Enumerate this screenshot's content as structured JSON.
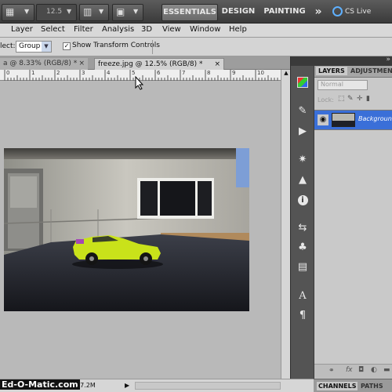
{
  "appbar": {
    "zoom_value": "12.5",
    "workspaces": [
      "ESSENTIALS",
      "DESIGN",
      "PAINTING"
    ],
    "more_label": "»",
    "cslive_label": "CS Live"
  },
  "menu": [
    "Layer",
    "Select",
    "Filter",
    "Analysis",
    "3D",
    "View",
    "Window",
    "Help"
  ],
  "options": {
    "select_label": "lect:",
    "select_value": "Group",
    "transform_label": "Show Transform Controls"
  },
  "tabs": [
    {
      "label": "a @ 8.33% (RGB/8) *",
      "close": "×"
    },
    {
      "label": "freeze.jpg @ 12.5% (RGB/8) *",
      "close": "×"
    }
  ],
  "ruler_labels": [
    "0",
    "1",
    "2",
    "3",
    "4",
    "5",
    "6",
    "7",
    "8",
    "9",
    "10",
    "11"
  ],
  "panel": {
    "tabs": [
      "LAYERS",
      "ADJUSTMENTS"
    ],
    "blend_mode": "Normal",
    "lock_label": "Lock:",
    "layer_name": "Background"
  },
  "status": {
    "watermark": "Ed-O-Matic.com",
    "doc_size": "37.2M"
  },
  "bottom_tabs": [
    "CHANNELS",
    "PATHS"
  ],
  "colors": {
    "accent": "#3a6fd8",
    "car": "#c9e21a",
    "sky": "#7d9ed6"
  },
  "icons": [
    "color-swatch-icon",
    "brush-presets-icon",
    "clone-source-icon",
    "adjustments-icon",
    "masks-icon",
    "info-icon",
    "history-icon",
    "actions-icon",
    "navigator-icon",
    "character-icon",
    "paragraph-icon"
  ]
}
